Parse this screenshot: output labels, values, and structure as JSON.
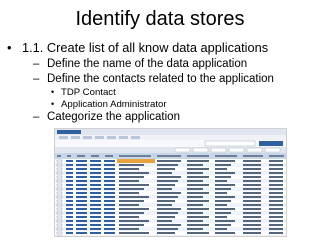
{
  "slide": {
    "title": "Identify data stores",
    "bullets": [
      {
        "level": 1,
        "marker": "•",
        "text": "1.1. Create list of all know data applications"
      },
      {
        "level": 2,
        "marker": "–",
        "text": "Define the name of the data application"
      },
      {
        "level": 2,
        "marker": "–",
        "text": "Define the contacts related to the application"
      },
      {
        "level": 3,
        "marker": "•",
        "text": "TDP Contact"
      },
      {
        "level": 3,
        "marker": "•",
        "text": "Application Administrator"
      },
      {
        "level": 2,
        "marker": "–",
        "text": " Categorize the application"
      }
    ]
  },
  "screenshot": {
    "row_count": 20,
    "colors": {
      "chrome": "#dfe6ef",
      "header": "#c7d6e9",
      "toolbar_blue": "#2f5f9e",
      "accent": "#e8a33c",
      "row_alt": "#f0f4fa"
    }
  }
}
